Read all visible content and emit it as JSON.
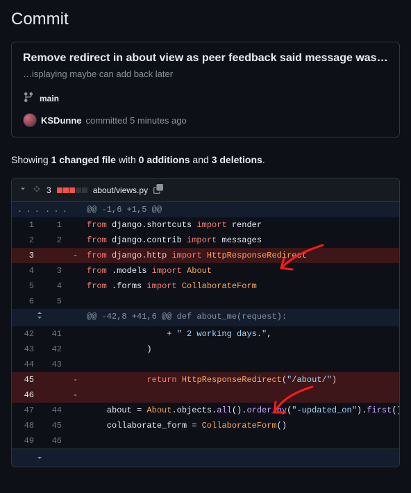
{
  "pageTitle": "Commit",
  "commit": {
    "title": "Remove redirect in about view as peer feedback said message was not d…",
    "body": "…isplaying maybe can add back later",
    "branch": "main",
    "author": "KSDunne",
    "timeSuffix": "committed 5 minutes ago"
  },
  "summary": {
    "prefix": "Showing ",
    "filePart": "1 changed file",
    "withText": " with ",
    "addPart": "0 additions",
    "andText": " and ",
    "delPart": "3 deletions",
    "dot": "."
  },
  "file": {
    "changeCount": "3",
    "path": "about/views.py"
  },
  "hunk1": "@@ -1,6 +1,5 @@",
  "hunk2": "@@ -42,8 +41,6 @@ def about_me(request):",
  "lines": [
    {
      "t": "ctx",
      "oL": "1",
      "nL": "1",
      "pre": "",
      "segs": [
        [
          "kw",
          "from"
        ],
        [
          "",
          " django.shortcuts "
        ],
        [
          "kw",
          "import"
        ],
        [
          "",
          " render"
        ]
      ]
    },
    {
      "t": "ctx",
      "oL": "2",
      "nL": "2",
      "pre": "",
      "segs": [
        [
          "kw",
          "from"
        ],
        [
          "",
          " django.contrib "
        ],
        [
          "kw",
          "import"
        ],
        [
          "",
          " messages"
        ]
      ]
    },
    {
      "t": "del",
      "oL": "3",
      "nL": "",
      "pre": "",
      "segs": [
        [
          "kw",
          "from"
        ],
        [
          "",
          " django.http "
        ],
        [
          "kw",
          "import"
        ],
        [
          "",
          " "
        ],
        [
          "cls",
          "HttpResponseRedirect"
        ]
      ]
    },
    {
      "t": "ctx",
      "oL": "4",
      "nL": "3",
      "pre": "",
      "segs": [
        [
          "kw",
          "from"
        ],
        [
          "",
          " .models "
        ],
        [
          "kw",
          "import"
        ],
        [
          "",
          " "
        ],
        [
          "cls",
          "About"
        ]
      ]
    },
    {
      "t": "ctx",
      "oL": "5",
      "nL": "4",
      "pre": "",
      "segs": [
        [
          "kw",
          "from"
        ],
        [
          "",
          " .forms "
        ],
        [
          "kw",
          "import"
        ],
        [
          "",
          " "
        ],
        [
          "cls",
          "CollaborateForm"
        ]
      ]
    },
    {
      "t": "ctx",
      "oL": "6",
      "nL": "5",
      "pre": "",
      "segs": [
        [
          "",
          ""
        ]
      ]
    }
  ],
  "lines2": [
    {
      "t": "ctx",
      "oL": "42",
      "nL": "41",
      "pre": "                ",
      "segs": [
        [
          "",
          "+ "
        ],
        [
          "str",
          "\" 2 working days.\""
        ],
        [
          "",
          ","
        ]
      ]
    },
    {
      "t": "ctx",
      "oL": "43",
      "nL": "42",
      "pre": "            ",
      "segs": [
        [
          "",
          ")"
        ]
      ]
    },
    {
      "t": "ctx",
      "oL": "44",
      "nL": "43",
      "pre": "",
      "segs": [
        [
          "",
          ""
        ]
      ]
    },
    {
      "t": "del",
      "oL": "45",
      "nL": "",
      "pre": "            ",
      "segs": [
        [
          "kw",
          "return"
        ],
        [
          "",
          " "
        ],
        [
          "cls",
          "HttpResponseRedirect"
        ],
        [
          "",
          "("
        ],
        [
          "str",
          "\"/about/\""
        ],
        [
          "",
          ")"
        ]
      ]
    },
    {
      "t": "del",
      "oL": "46",
      "nL": "",
      "pre": "",
      "segs": [
        [
          "",
          ""
        ]
      ]
    },
    {
      "t": "ctx",
      "oL": "47",
      "nL": "44",
      "pre": "    ",
      "segs": [
        [
          "",
          "about = "
        ],
        [
          "cls",
          "About"
        ],
        [
          "",
          ".objects."
        ],
        [
          "fn",
          "all"
        ],
        [
          "",
          "()."
        ],
        [
          "fn",
          "order_by"
        ],
        [
          "",
          "("
        ],
        [
          "str",
          "\"-updated_on\""
        ],
        [
          "",
          ")."
        ],
        [
          "fn",
          "first"
        ],
        [
          "",
          "()"
        ]
      ]
    },
    {
      "t": "ctx",
      "oL": "48",
      "nL": "45",
      "pre": "    ",
      "segs": [
        [
          "",
          "collaborate_form = "
        ],
        [
          "cls",
          "CollaborateForm"
        ],
        [
          "",
          "()"
        ]
      ]
    },
    {
      "t": "ctx",
      "oL": "49",
      "nL": "46",
      "pre": "",
      "segs": [
        [
          "",
          ""
        ]
      ]
    }
  ]
}
